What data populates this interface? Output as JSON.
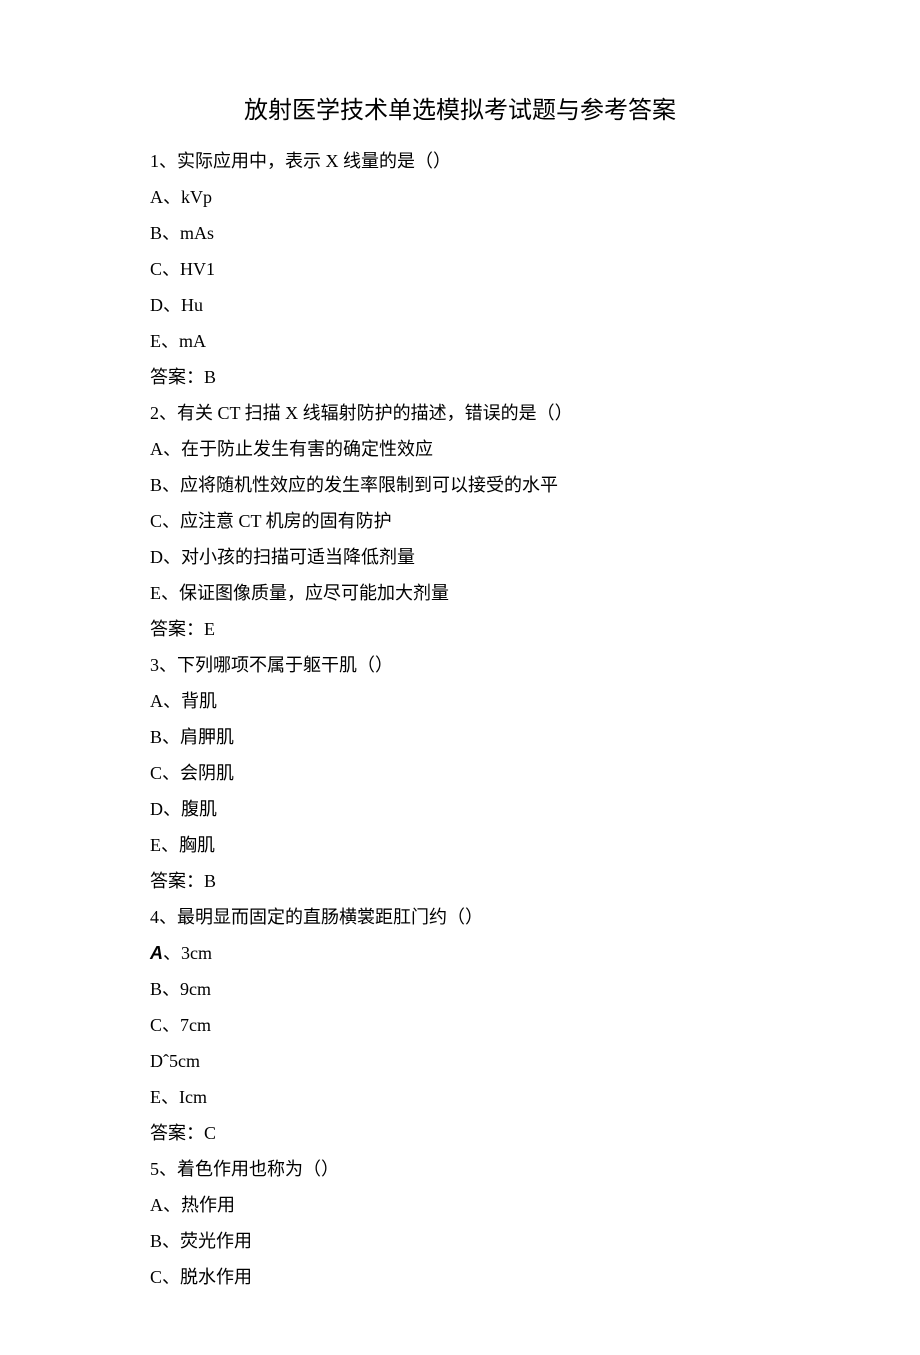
{
  "title": "放射医学技术单选模拟考试题与参考答案",
  "q1": {
    "stem": "1、实际应用中，表示 X 线量的是（）",
    "a": "A、kVp",
    "b": "B、mAs",
    "c": "C、HV1",
    "d": "D、Hu",
    "e": "E、mA",
    "ans": "答案：B"
  },
  "q2": {
    "stem": "2、有关 CT 扫描 X 线辐射防护的描述，错误的是（）",
    "a": "A、在于防止发生有害的确定性效应",
    "b": "B、应将随机性效应的发生率限制到可以接受的水平",
    "c": "C、应注意 CT 机房的固有防护",
    "d": "D、对小孩的扫描可适当降低剂量",
    "e": "E、保证图像质量，应尽可能加大剂量",
    "ans": "答案：E"
  },
  "q3": {
    "stem": "3、下列哪项不属于躯干肌（）",
    "a": "A、背肌",
    "b": "B、肩胛肌",
    "c": "C、会阴肌",
    "d": "D、腹肌",
    "e": "E、胸肌",
    "ans": "答案：B"
  },
  "q4": {
    "stem": "4、最明显而固定的直肠横裳距肛门约（）",
    "a_prefix": "A",
    "a_rest": "、3cm",
    "b": "B、9cm",
    "c": "C、7cm",
    "d": "Dˆ5cm",
    "e": "E、Icm",
    "ans": "答案：C"
  },
  "q5": {
    "stem": "5、着色作用也称为（）",
    "a": "A、热作用",
    "b": "B、荧光作用",
    "c": "C、脱水作用"
  }
}
